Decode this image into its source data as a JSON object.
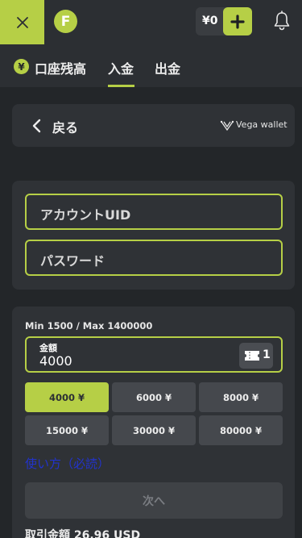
{
  "header": {
    "logo_letter": "F",
    "balance": "¥0",
    "accent_color": "#b6cf46"
  },
  "tabs": [
    {
      "label": "口座残高"
    },
    {
      "label": "入金",
      "active": true
    },
    {
      "label": "出金"
    }
  ],
  "tab_badge": "¥",
  "back_card": {
    "back_label": "戻る",
    "wallet_name": "Vega wallet"
  },
  "account": {
    "uid_placeholder": "アカウントUID",
    "password_placeholder": "パスワード"
  },
  "amount": {
    "limits": "Min 1500 / Max 1400000",
    "label": "金額",
    "value": "4000",
    "ticket_count": "1",
    "presets": [
      "4000 ¥",
      "6000 ¥",
      "8000 ¥",
      "15000 ¥",
      "30000 ¥",
      "80000 ¥"
    ],
    "selected_preset": "4000 ¥",
    "howto_link": "使い方（必読）",
    "next_label": "次へ",
    "total": "取引金額 26.96 USD"
  }
}
